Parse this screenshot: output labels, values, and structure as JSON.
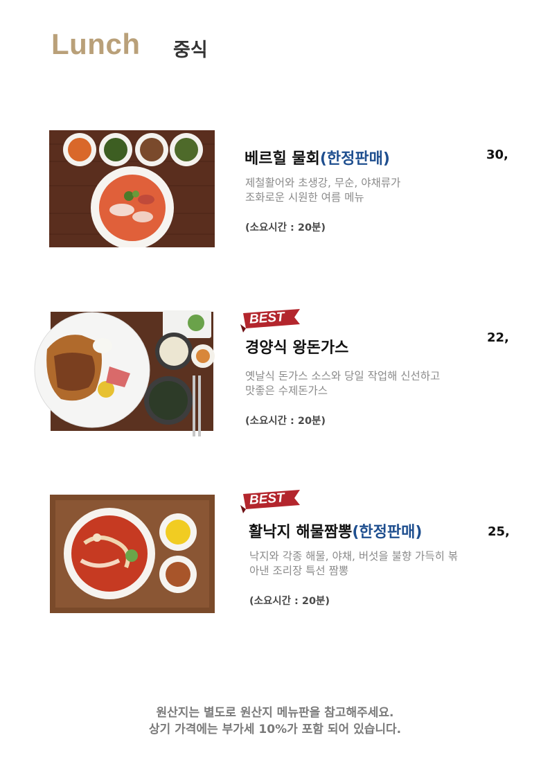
{
  "header": {
    "title": "Lunch",
    "category": "중식"
  },
  "menu": [
    {
      "name": "베르힐 물회",
      "limited": "(한정판매)",
      "price": "30,",
      "desc_line1": "제철활어와 초생강, 무순, 야채류가",
      "desc_line2": "조화로운 시원한 여름 메뉴",
      "time": "(소요시간 : 20분)",
      "badge": ""
    },
    {
      "name": "경양식 왕돈가스",
      "limited": "",
      "price": "22,",
      "desc_line1": "옛날식 돈가스 소스와 당일 작업해 신선하고",
      "desc_line2": "맛좋은 수제돈가스",
      "time": "(소요시간 : 20분)",
      "badge": "BEST"
    },
    {
      "name": "활낙지 해물짬뽕",
      "limited": "(한정판매)",
      "price": "25,",
      "desc_line1": "낙지와 각종 해물, 야채, 버섯을 불향 가득히 볶",
      "desc_line2": "아낸 조리장 특선 짬뽕",
      "time": "(소요시간 : 20분)",
      "badge": "BEST"
    }
  ],
  "footer": {
    "line1": "원산지는 별도로 원산지 메뉴판을 참고해주세요.",
    "line2": "상기 가격에는 부가세 10%가 포함 되어 있습니다."
  },
  "colors": {
    "title": "#b9a079",
    "limited": "#1f4f8f",
    "badge": "#b3262d"
  }
}
